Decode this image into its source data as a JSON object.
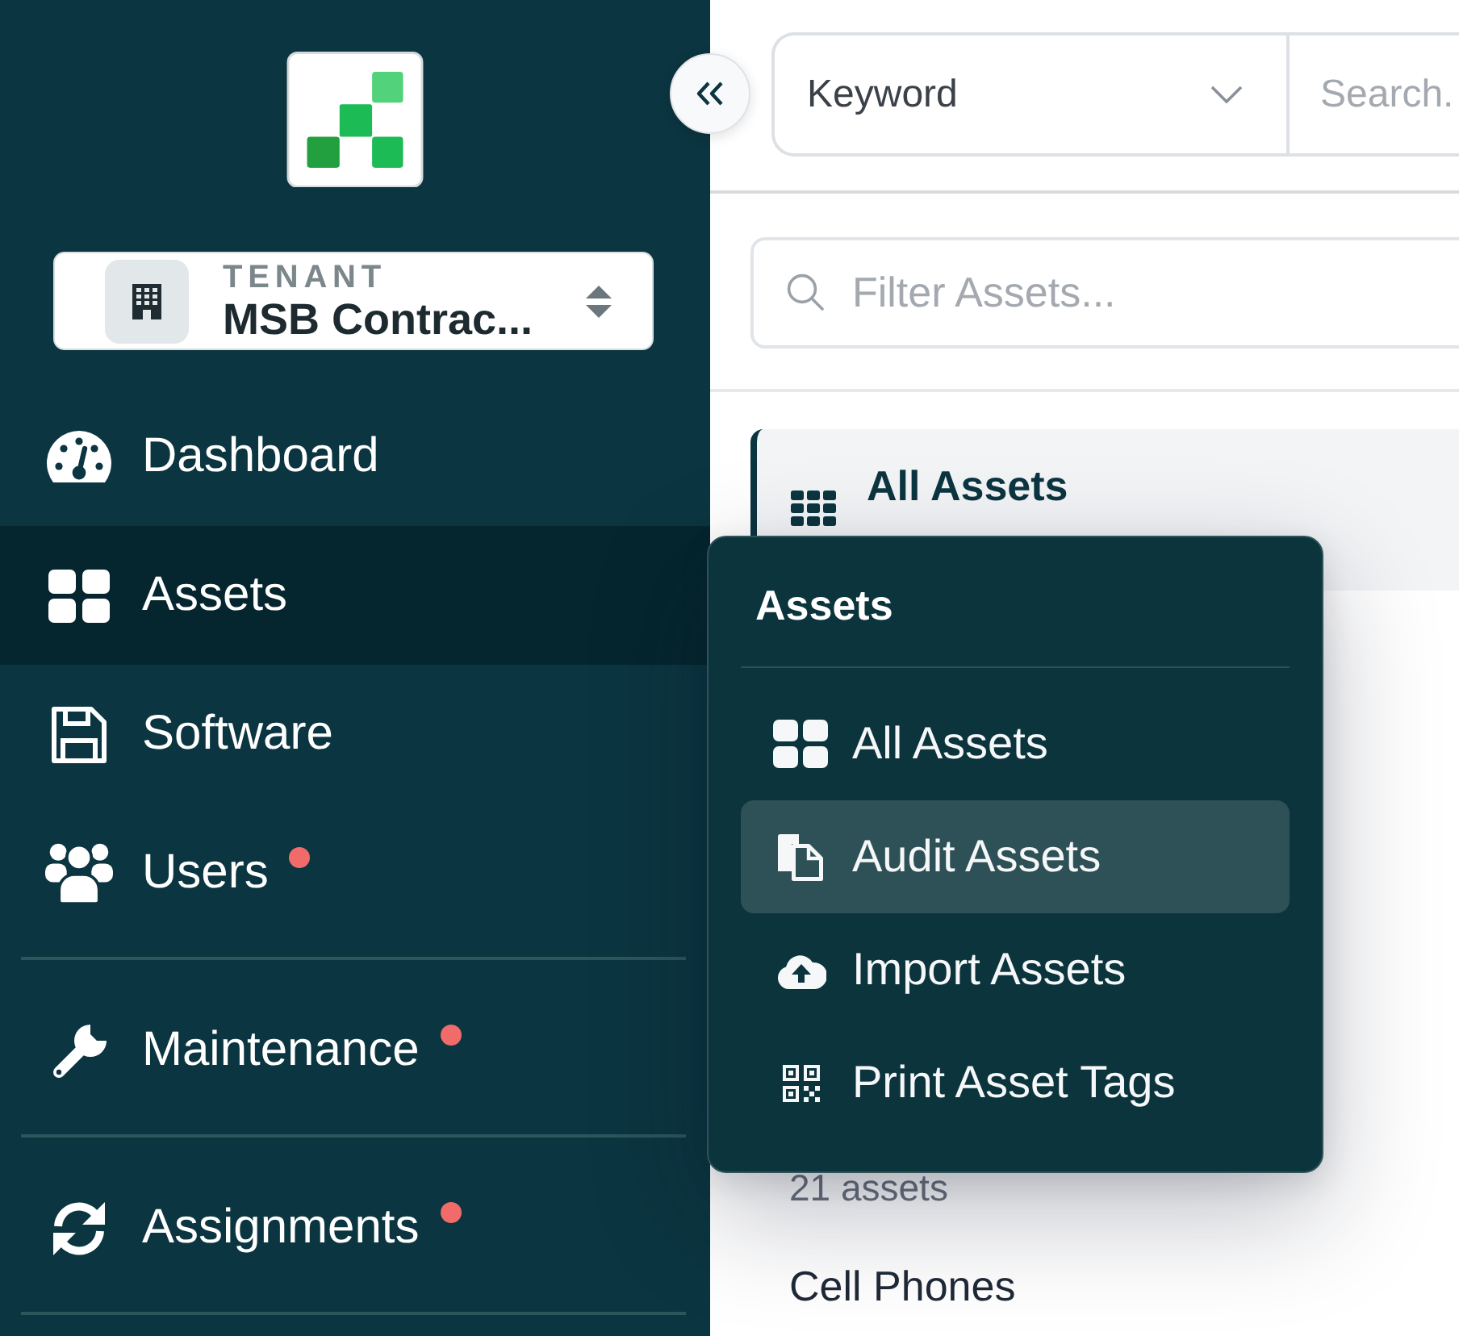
{
  "sidebar": {
    "tenant": {
      "label": "TENANT",
      "name": "MSB Contrac..."
    },
    "nav_groups": [
      {
        "items": [
          {
            "label": "Dashboard",
            "selected": false,
            "badge": false
          },
          {
            "label": "Assets",
            "selected": true,
            "badge": false
          },
          {
            "label": "Software",
            "selected": false,
            "badge": false
          },
          {
            "label": "Users",
            "selected": false,
            "badge": true
          }
        ]
      },
      {
        "items": [
          {
            "label": "Maintenance",
            "selected": false,
            "badge": true
          }
        ]
      },
      {
        "items": [
          {
            "label": "Assignments",
            "selected": false,
            "badge": true
          }
        ]
      }
    ]
  },
  "search_bar": {
    "mode": "Keyword",
    "placeholder": "Search."
  },
  "filter": {
    "placeholder": "Filter Assets..."
  },
  "categories": [
    {
      "kind": "summary",
      "title": "All Assets",
      "selected": true
    },
    {
      "kind": "category",
      "count": "21 assets",
      "selected": false
    },
    {
      "kind": "category",
      "title": "Cell Phones",
      "selected": false
    }
  ],
  "flyout": {
    "title": "Assets",
    "items": [
      {
        "label": "All Assets",
        "selected": false
      },
      {
        "label": "Audit Assets",
        "selected": true
      },
      {
        "label": "Import Assets",
        "selected": false
      },
      {
        "label": "Print Asset Tags",
        "selected": false
      }
    ]
  }
}
